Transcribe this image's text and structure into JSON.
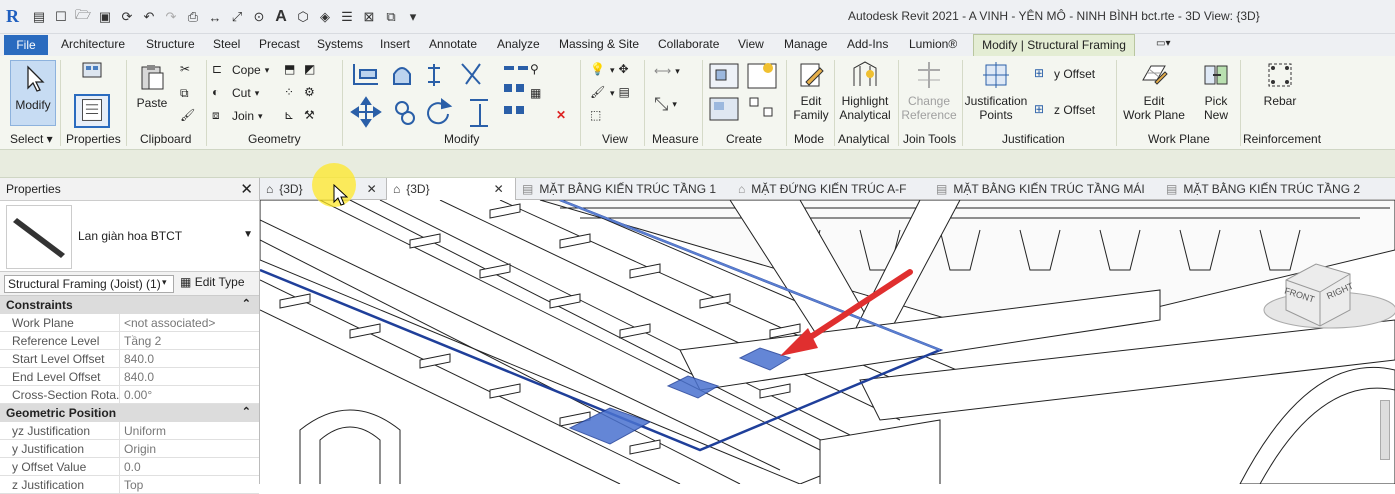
{
  "app": {
    "logo": "R",
    "title": "Autodesk Revit 2021 - A VINH - YÊN MÔ - NINH BÌNH bct.rte - 3D View: {3D}"
  },
  "ribbon_tabs": {
    "file": "File",
    "items": [
      "Architecture",
      "Structure",
      "Steel",
      "Precast",
      "Systems",
      "Insert",
      "Annotate",
      "Analyze",
      "Massing & Site",
      "Collaborate",
      "View",
      "Manage",
      "Add-Ins",
      "Lumion®"
    ],
    "active": "Modify | Structural Framing"
  },
  "ribbon": {
    "modify": "Modify",
    "properties": "Properties",
    "paste": "Paste",
    "cope": "Cope",
    "cut": "Cut",
    "join": "Join",
    "edit_family_1": "Edit",
    "edit_family_2": "Family",
    "highlight_1": "Highlight",
    "highlight_2": "Analytical",
    "change_ref_1": "Change",
    "change_ref_2": "Reference",
    "just_points_1": "Justification",
    "just_points_2": "Points",
    "y_offset": "y Offset",
    "z_offset": "z Offset",
    "edit_wp_1": "Edit",
    "edit_wp_2": "Work Plane",
    "pick_new_1": "Pick",
    "pick_new_2": "New",
    "rebar": "Rebar",
    "groups": {
      "select": "Select ▾",
      "properties": "Properties",
      "clipboard": "Clipboard",
      "geometry": "Geometry",
      "modify": "Modify",
      "view": "View",
      "measure": "Measure",
      "create": "Create",
      "mode": "Mode",
      "analytical": "Analytical",
      "join_tools": "Join Tools",
      "justification": "Justification",
      "work_plane": "Work Plane",
      "reinforcement": "Reinforcement"
    }
  },
  "properties": {
    "title": "Properties",
    "type_name": "Lan giàn hoa BTCT",
    "selector": "Structural Framing (Joist) (1)",
    "edit_type": "Edit Type",
    "sections": [
      {
        "name": "Constraints",
        "rows": [
          [
            "Work Plane",
            "<not associated>"
          ],
          [
            "Reference Level",
            "Tầng 2"
          ],
          [
            "Start Level Offset",
            "840.0"
          ],
          [
            "End Level Offset",
            "840.0"
          ],
          [
            "Cross-Section Rota...",
            "0.00°"
          ]
        ]
      },
      {
        "name": "Geometric Position",
        "rows": [
          [
            "yz Justification",
            "Uniform"
          ],
          [
            "y Justification",
            "Origin"
          ],
          [
            "y Offset Value",
            "0.0"
          ],
          [
            "z Justification",
            "Top"
          ]
        ]
      }
    ]
  },
  "view_tabs": [
    {
      "label": "{3D}",
      "icon": "3d-house-icon"
    },
    {
      "label": "{3D}",
      "icon": "3d-house-icon"
    },
    {
      "label": "MẶT BẰNG KIẾN TRÚC TẦNG 1",
      "icon": "floor-plan-icon"
    },
    {
      "label": "MẶT ĐỨNG KIẾN TRÚC A-F",
      "icon": "elevation-icon"
    },
    {
      "label": "MẶT BẰNG KIẾN TRÚC TẦNG MÁI",
      "icon": "floor-plan-icon"
    },
    {
      "label": "MẶT BẰNG KIẾN TRÚC TẦNG 2",
      "icon": "floor-plan-icon"
    }
  ],
  "viewcube": {
    "front": "FRONT",
    "right": "RIGHT"
  },
  "colors": {
    "accent": "#2a6bbf",
    "selection": "#1f3f9a",
    "highlight": "#e02f2f"
  }
}
